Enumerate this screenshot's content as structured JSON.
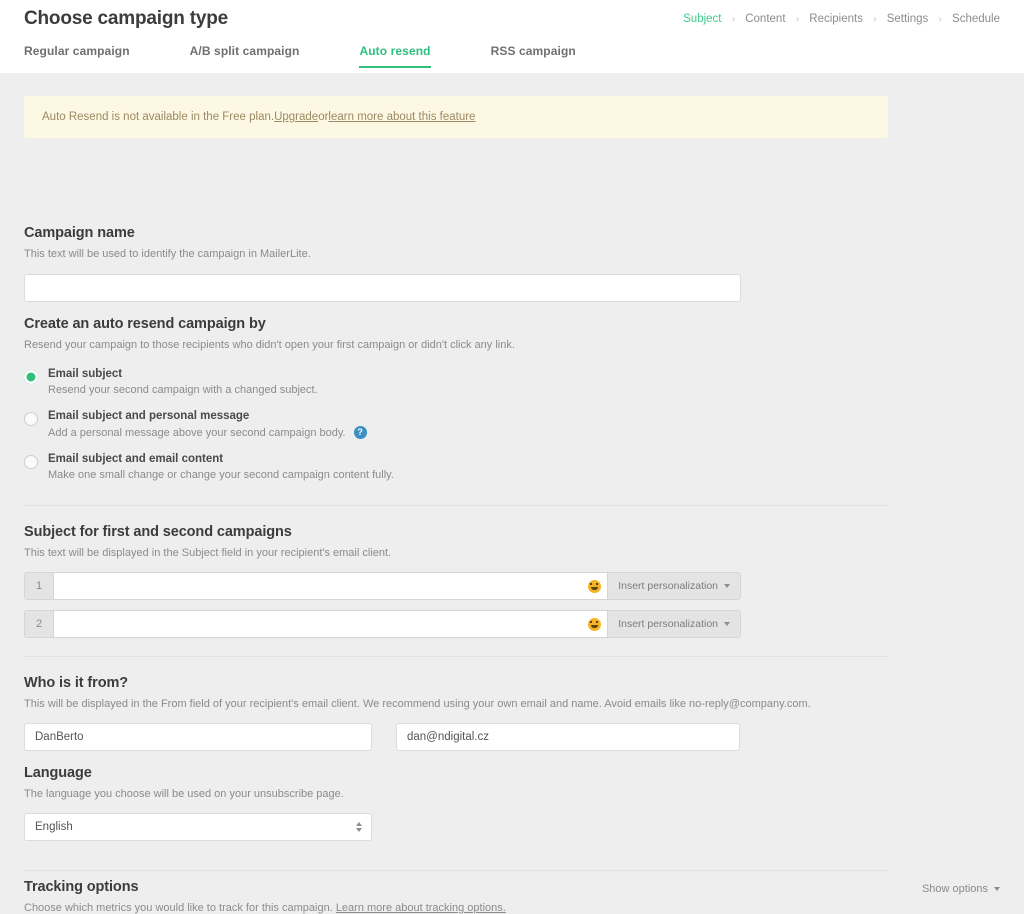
{
  "header": {
    "title": "Choose campaign type",
    "breadcrumb": [
      {
        "label": "Subject",
        "active": true
      },
      {
        "label": "Content",
        "active": false
      },
      {
        "label": "Recipients",
        "active": false
      },
      {
        "label": "Settings",
        "active": false
      },
      {
        "label": "Schedule",
        "active": false
      }
    ],
    "tabs": [
      {
        "label": "Regular campaign",
        "active": false
      },
      {
        "label": "A/B split campaign",
        "active": false
      },
      {
        "label": "Auto resend",
        "active": true
      },
      {
        "label": "RSS campaign",
        "active": false
      }
    ]
  },
  "notice": {
    "text_before": "Auto Resend is not available in the Free plan. ",
    "link_upgrade": "Upgrade",
    "text_middle": " or ",
    "link_learn_more": "learn more about this feature"
  },
  "campaign_name": {
    "title": "Campaign name",
    "description": "This text will be used to identify the campaign in MailerLite.",
    "value": "",
    "placeholder": ""
  },
  "create_by": {
    "title": "Create an auto resend campaign by",
    "description": "Resend your campaign to those recipients who didn't open your first campaign or didn't click any link.",
    "options": [
      {
        "label": "Email subject",
        "description": "Resend your second campaign with a changed subject.",
        "selected": true,
        "help": ""
      },
      {
        "label": "Email subject and personal message",
        "description": "Add a personal message above your second campaign body.",
        "selected": false,
        "help": "?"
      },
      {
        "label": "Email subject and email content",
        "description": "Make one small change or change your second campaign content fully.",
        "selected": false,
        "help": ""
      }
    ]
  },
  "subject": {
    "title": "Subject for first and second campaigns",
    "description": "This text will be displayed in the Subject field in your recipient's email client.",
    "personalization_label": "Insert personalization",
    "rows": [
      {
        "number": "1",
        "value": "",
        "placeholder": ""
      },
      {
        "number": "2",
        "value": "",
        "placeholder": ""
      }
    ]
  },
  "from": {
    "title": "Who is it from?",
    "description": "This will be displayed in the From field of your recipient's email client. We recommend using your own email and name. Avoid emails like no-reply@company.com.",
    "name_value": "DanBerto",
    "name_placeholder": "",
    "email_value": "dan@ndigital.cz",
    "email_placeholder": ""
  },
  "language": {
    "title": "Language",
    "description": "The language you choose will be used on your unsubscribe page.",
    "selected": "English"
  },
  "tracking": {
    "title": "Tracking options",
    "description_before": "Choose which metrics you would like to track for this campaign. ",
    "link_label": "Learn more about tracking options.",
    "show_options_label": "Show options"
  },
  "colors": {
    "accent_green": "#2ec07c",
    "page_bg": "#eeeeee",
    "notice_bg": "#fcf8e3",
    "help_blue": "#3b8fc4",
    "emoji_yellow": "#f5b325"
  }
}
